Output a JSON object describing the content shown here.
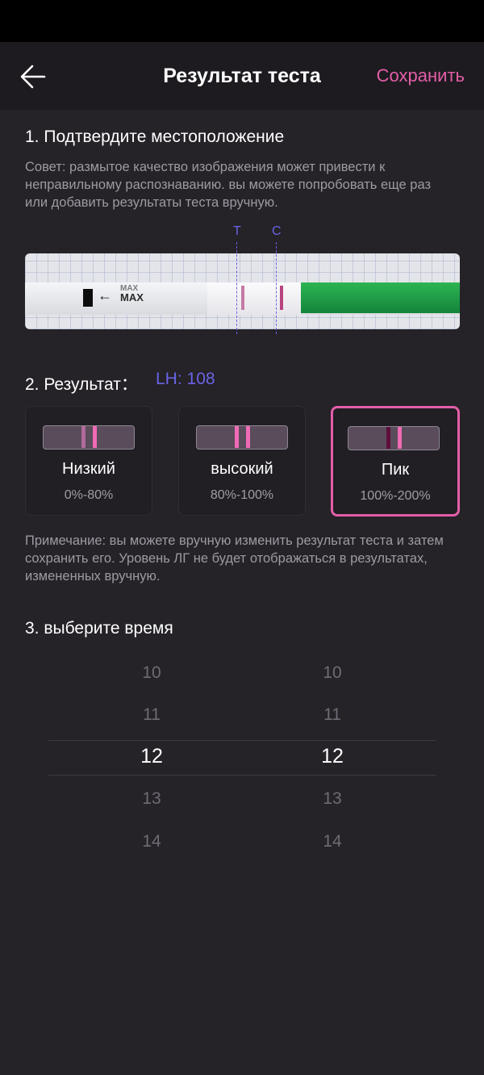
{
  "header": {
    "title": "Результат теста",
    "save_label": "Сохранить"
  },
  "location_section": {
    "title": "1. Подтвердите местоположение",
    "hint": "Совет: размытое качество изображения может привести к неправильному распознаванию. вы можете попробовать еще раз или добавить результаты теста вручную.",
    "marker_t": "T",
    "marker_c": "C",
    "strip_text": "MAX"
  },
  "result_section": {
    "title": "2. Результат：",
    "lh_value": "LH: 108",
    "cards": [
      {
        "label": "Низкий",
        "range": "0%-80%",
        "selected": false
      },
      {
        "label": "высокий",
        "range": "80%-100%",
        "selected": false
      },
      {
        "label": "Пик",
        "range": "100%-200%",
        "selected": true
      }
    ],
    "note": "Примечание: вы можете вручную изменить результат теста и затем сохранить его. Уровень ЛГ не будет отображаться в результатах, измененных вручную."
  },
  "time_section": {
    "title": "3. выберите время",
    "hours": [
      "10",
      "11",
      "12",
      "13",
      "14"
    ],
    "minutes": [
      "10",
      "11",
      "12",
      "13",
      "14"
    ],
    "selected_hour": "12",
    "selected_minute": "12"
  },
  "colors": {
    "accent_pink": "#e35ea8",
    "accent_purple": "#6a63e6",
    "background": "#252228"
  }
}
